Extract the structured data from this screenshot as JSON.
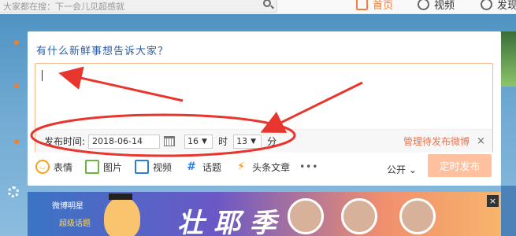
{
  "search": {
    "placeholder": "大家都在搜：下一会儿见超感就"
  },
  "nav": {
    "home": "首页",
    "video": "视频",
    "find": "发现"
  },
  "composer": {
    "prompt": "有什么新鲜事想告诉大家？",
    "schedule_label": "发布时间:",
    "date": "2018-06-14",
    "hour": "16",
    "hour_unit": "时",
    "minute": "13",
    "minute_unit": "分",
    "manage_link": "管理待发布微博",
    "close": "×"
  },
  "toolbar": {
    "emoji": "表情",
    "picture": "图片",
    "video": "视频",
    "topic": "话题",
    "article": "头条文章",
    "more": "•••",
    "visibility": "公开",
    "publish": "定时发布"
  },
  "banner": {
    "logo": "微博明星",
    "subtitle": "超级话题",
    "headline": "壮 耶 季",
    "close": "×"
  },
  "colors": {
    "accent": "#fa7d3c",
    "annotation": "#e8362e",
    "publish_disabled": "#ffc09f"
  }
}
